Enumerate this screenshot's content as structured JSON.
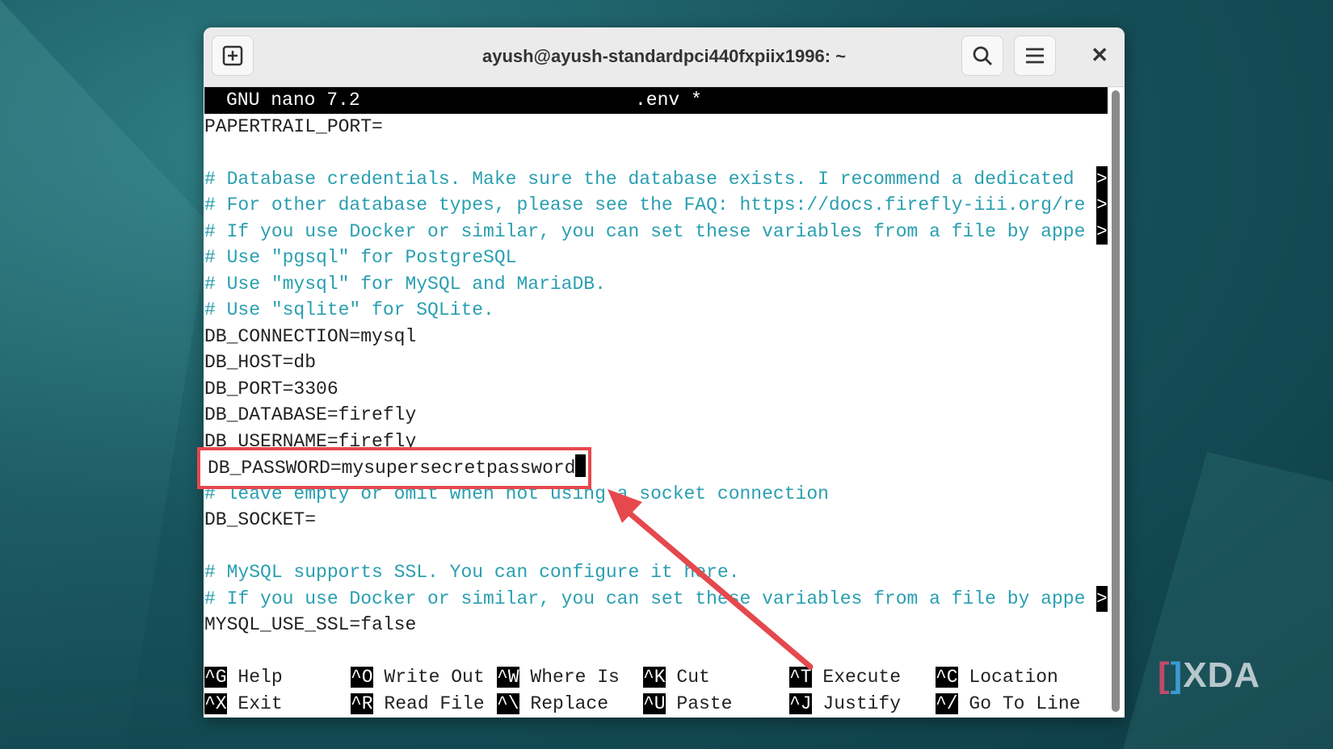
{
  "window": {
    "title": "ayush@ayush-standardpci440fxpiix1996: ~"
  },
  "nano": {
    "version": "GNU nano 7.2",
    "filename": ".env *",
    "lines": [
      {
        "text": "PAPERTRAIL_PORT=",
        "type": "code"
      },
      {
        "text": "",
        "type": "code"
      },
      {
        "text": "# Database credentials. Make sure the database exists. I recommend a dedicated ",
        "type": "comment",
        "more": true
      },
      {
        "text": "# For other database types, please see the FAQ: https://docs.firefly-iii.org/re",
        "type": "comment",
        "more": true
      },
      {
        "text": "# If you use Docker or similar, you can set these variables from a file by appe",
        "type": "comment",
        "more": true
      },
      {
        "text": "# Use \"pgsql\" for PostgreSQL",
        "type": "comment"
      },
      {
        "text": "# Use \"mysql\" for MySQL and MariaDB.",
        "type": "comment"
      },
      {
        "text": "# Use \"sqlite\" for SQLite.",
        "type": "comment"
      },
      {
        "text": "DB_CONNECTION=mysql",
        "type": "code"
      },
      {
        "text": "DB_HOST=db",
        "type": "code"
      },
      {
        "text": "DB_PORT=3306",
        "type": "code"
      },
      {
        "text": "DB_DATABASE=firefly",
        "type": "code"
      },
      {
        "text": "DB_USERNAME=firefly",
        "type": "code"
      },
      {
        "text": "DB_PASSWORD=mysupersecretpassword",
        "type": "code",
        "cursor": true
      },
      {
        "text": "# leave empty or omit when not using a socket connection",
        "type": "comment"
      },
      {
        "text": "DB_SOCKET=",
        "type": "code"
      },
      {
        "text": "",
        "type": "code"
      },
      {
        "text": "# MySQL supports SSL. You can configure it here.",
        "type": "comment"
      },
      {
        "text": "# If you use Docker or similar, you can set these variables from a file by appe",
        "type": "comment",
        "more": true
      },
      {
        "text": "MYSQL_USE_SSL=false",
        "type": "code"
      },
      {
        "text": "",
        "type": "code"
      }
    ],
    "more_marker": ">",
    "shortcuts": [
      {
        "key": "^G",
        "label": "Help"
      },
      {
        "key": "^O",
        "label": "Write Out"
      },
      {
        "key": "^W",
        "label": "Where Is"
      },
      {
        "key": "^K",
        "label": "Cut"
      },
      {
        "key": "^T",
        "label": "Execute"
      },
      {
        "key": "^C",
        "label": "Location"
      },
      {
        "key": "^X",
        "label": "Exit"
      },
      {
        "key": "^R",
        "label": "Read File"
      },
      {
        "key": "^\\",
        "label": "Replace"
      },
      {
        "key": "^U",
        "label": "Paste"
      },
      {
        "key": "^J",
        "label": "Justify"
      },
      {
        "key": "^/",
        "label": "Go To Line"
      }
    ]
  },
  "highlight": {
    "text": "DB_PASSWORD=mysupersecretpassword",
    "color": "#e5484d"
  },
  "watermark": "XDA",
  "icons": {
    "new_tab": "new-tab-icon",
    "search": "search-icon",
    "menu": "hamburger-menu-icon",
    "close": "close-icon"
  }
}
